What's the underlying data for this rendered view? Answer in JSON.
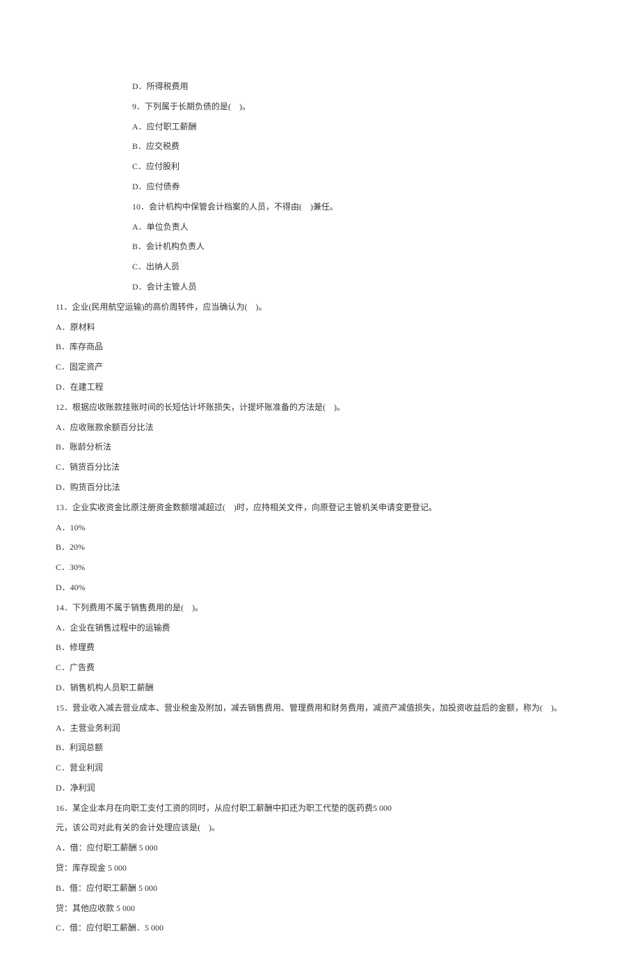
{
  "lines": [
    {
      "indent": 2,
      "text": "D．所得税费用"
    },
    {
      "indent": 2,
      "text": "9．下列属于长期负债的是(　)。"
    },
    {
      "indent": 2,
      "text": "A．应付职工薪酬"
    },
    {
      "indent": 2,
      "text": "B．应交税费"
    },
    {
      "indent": 2,
      "text": "C．应付股利"
    },
    {
      "indent": 2,
      "text": "D．应付债券"
    },
    {
      "indent": 2,
      "text": "10．会计机构中保管会计档案的人员，不得由(　)兼任。"
    },
    {
      "indent": 2,
      "text": "A．单位负责人"
    },
    {
      "indent": 2,
      "text": "B．会计机构负责人"
    },
    {
      "indent": 2,
      "text": "C．出纳人员"
    },
    {
      "indent": 2,
      "text": "D．会计主管人员"
    },
    {
      "indent": 1,
      "text": "11．企业(民用航空运输)的高价周转件，应当确认为(　)。"
    },
    {
      "indent": 1,
      "text": "A．原材料"
    },
    {
      "indent": 1,
      "text": "B．库存商品"
    },
    {
      "indent": 1,
      "text": "C．固定资产"
    },
    {
      "indent": 1,
      "text": "D．在建工程"
    },
    {
      "indent": 1,
      "text": "12．根据应收账款挂账时间的长短估计坏账损失，计提坏账准备的方法是(　)。"
    },
    {
      "indent": 1,
      "text": "A．应收账款余额百分比法"
    },
    {
      "indent": 1,
      "text": "B．账龄分析法"
    },
    {
      "indent": 1,
      "text": "C．销货百分比法"
    },
    {
      "indent": 1,
      "text": "D．购货百分比法"
    },
    {
      "indent": 1,
      "text": "13．企业实收资金比原注册资金数额增减超过(　)时，应持相关文件，向原登记主管机关申请变更登记。"
    },
    {
      "indent": 1,
      "text": "A．10%"
    },
    {
      "indent": 1,
      "text": "B．20%"
    },
    {
      "indent": 1,
      "text": "C．30%"
    },
    {
      "indent": 1,
      "text": "D．40%"
    },
    {
      "indent": 1,
      "text": "14．下列费用不属于销售费用的是(　)。"
    },
    {
      "indent": 1,
      "text": "A．企业在销售过程中的运输费"
    },
    {
      "indent": 1,
      "text": "B．修理费"
    },
    {
      "indent": 1,
      "text": "C．广告费"
    },
    {
      "indent": 1,
      "text": "D．销售机构人员职工薪酬"
    },
    {
      "indent": 1,
      "text": "15．营业收入减去营业成本、营业税金及附加，减去销售费用、管理费用和财务费用，减资产减值损失，加投资收益后的金额，称为(　)。"
    },
    {
      "indent": 1,
      "text": "A．主营业务利润"
    },
    {
      "indent": 1,
      "text": "B．利润总额"
    },
    {
      "indent": 1,
      "text": "C．营业利润"
    },
    {
      "indent": 1,
      "text": "D．净利润"
    },
    {
      "indent": 1,
      "text": "16．某企业本月在向职工支付工资的同时，从应付职工薪酬中扣还为职工代垫的医药费5 000"
    },
    {
      "indent": 1,
      "text": "元，该公司对此有关的会计处理应该是(　)。"
    },
    {
      "indent": 1,
      "text": "A．借：应付职工薪酬 5 000"
    },
    {
      "indent": 1,
      "text": "贷：库存现金 5 000"
    },
    {
      "indent": 1,
      "text": "B．借：应付职工薪酬 5 000"
    },
    {
      "indent": 1,
      "text": "贷：其他应收款 5 000"
    },
    {
      "indent": 1,
      "text": "C．借：应付职工薪酬．5 000"
    }
  ]
}
